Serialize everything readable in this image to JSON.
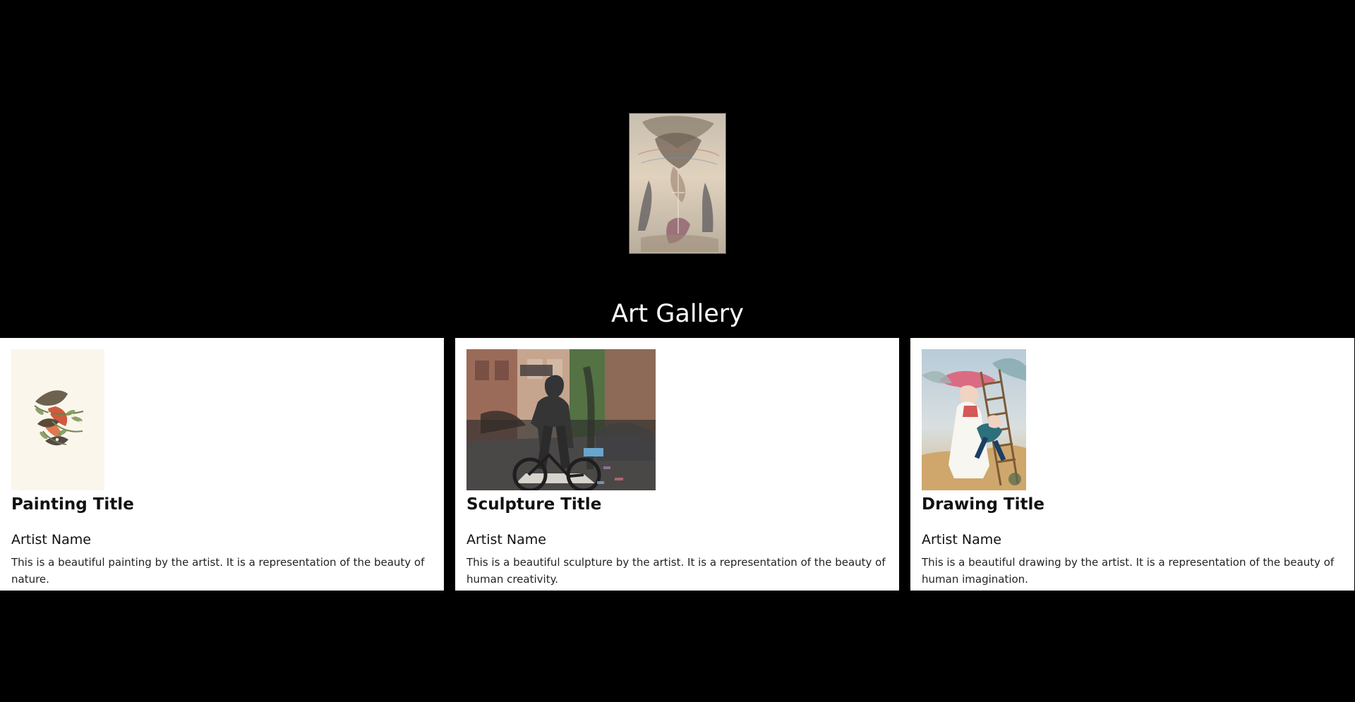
{
  "page": {
    "background": "#000000",
    "accent": "#ffffff"
  },
  "header": {
    "title": "Art Gallery",
    "hero_image_icon": "illustrated-artwork-image"
  },
  "cards": [
    {
      "type": "painting",
      "title": "Painting Title",
      "artist": "Artist Name",
      "description": "This is a beautiful painting by the artist. It is a representation of the beauty of nature.",
      "image_icon": "bird-painting-image"
    },
    {
      "type": "sculpture",
      "title": "Sculpture Title",
      "artist": "Artist Name",
      "description": "This is a beautiful sculpture by the artist. It is a representation of the beauty of human creativity.",
      "image_icon": "street-sculpture-image"
    },
    {
      "type": "drawing",
      "title": "Drawing Title",
      "artist": "Artist Name",
      "description": "This is a beautiful drawing by the artist. It is a representation of the beauty of human imagination.",
      "image_icon": "caricature-drawing-image"
    }
  ]
}
